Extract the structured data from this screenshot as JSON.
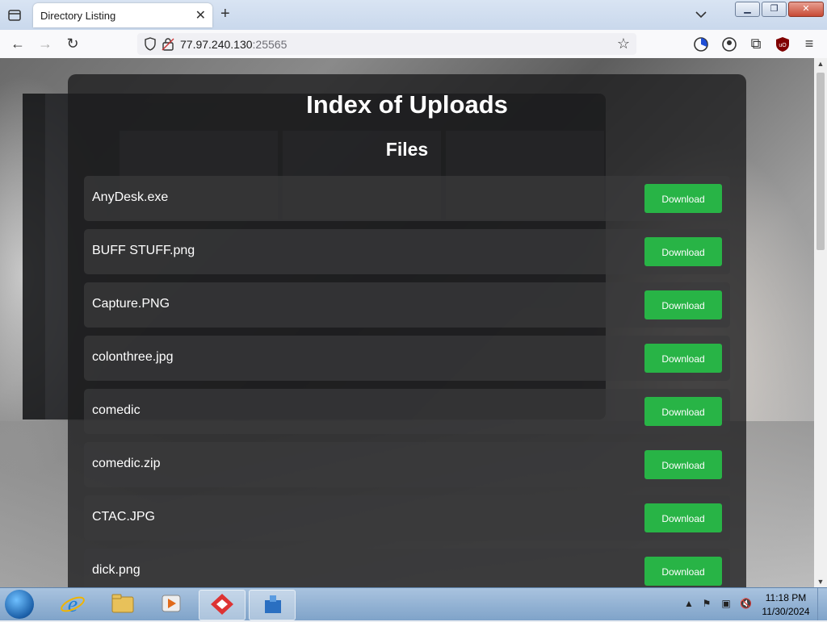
{
  "browser": {
    "tab_title": "Directory Listing",
    "url_host": "77.97.240.130",
    "url_port": ":25565"
  },
  "page": {
    "title": "Index of Uploads",
    "files_heading": "Files",
    "download_label": "Download",
    "files": [
      {
        "name": "AnyDesk.exe"
      },
      {
        "name": "BUFF STUFF.png"
      },
      {
        "name": "Capture.PNG"
      },
      {
        "name": "colonthree.jpg"
      },
      {
        "name": "comedic"
      },
      {
        "name": "comedic.zip"
      },
      {
        "name": "CTAC.JPG"
      },
      {
        "name": "dick.png"
      }
    ]
  },
  "taskbar": {
    "time": "11:18 PM",
    "date": "11/30/2024"
  },
  "colors": {
    "download_button": "#28b446",
    "container_bg": "#1c1c1e",
    "row_bg": "#3a3a3c"
  }
}
